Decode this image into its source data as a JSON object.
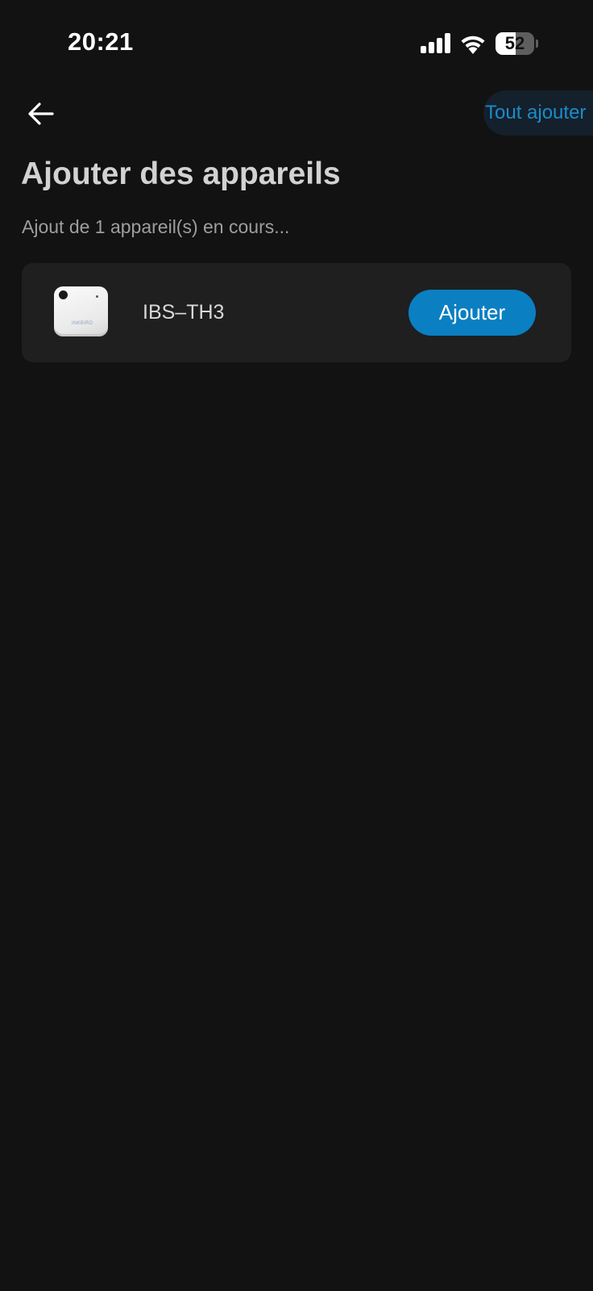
{
  "status_bar": {
    "time": "20:21",
    "battery_level": "52",
    "battery_fraction": 0.52
  },
  "header": {
    "back_icon": "arrow-left-icon",
    "add_all_label": "Tout ajouter"
  },
  "page": {
    "title": "Ajouter des appareils",
    "subtitle": "Ajout de 1 appareil(s) en cours..."
  },
  "devices": [
    {
      "name": "IBS–TH3",
      "image_brand": "INKBIRD",
      "add_label": "Ajouter"
    }
  ],
  "colors": {
    "background": "#121212",
    "card": "#1f1f1f",
    "accent": "#0a7fc2",
    "link": "#1a8ccc"
  }
}
